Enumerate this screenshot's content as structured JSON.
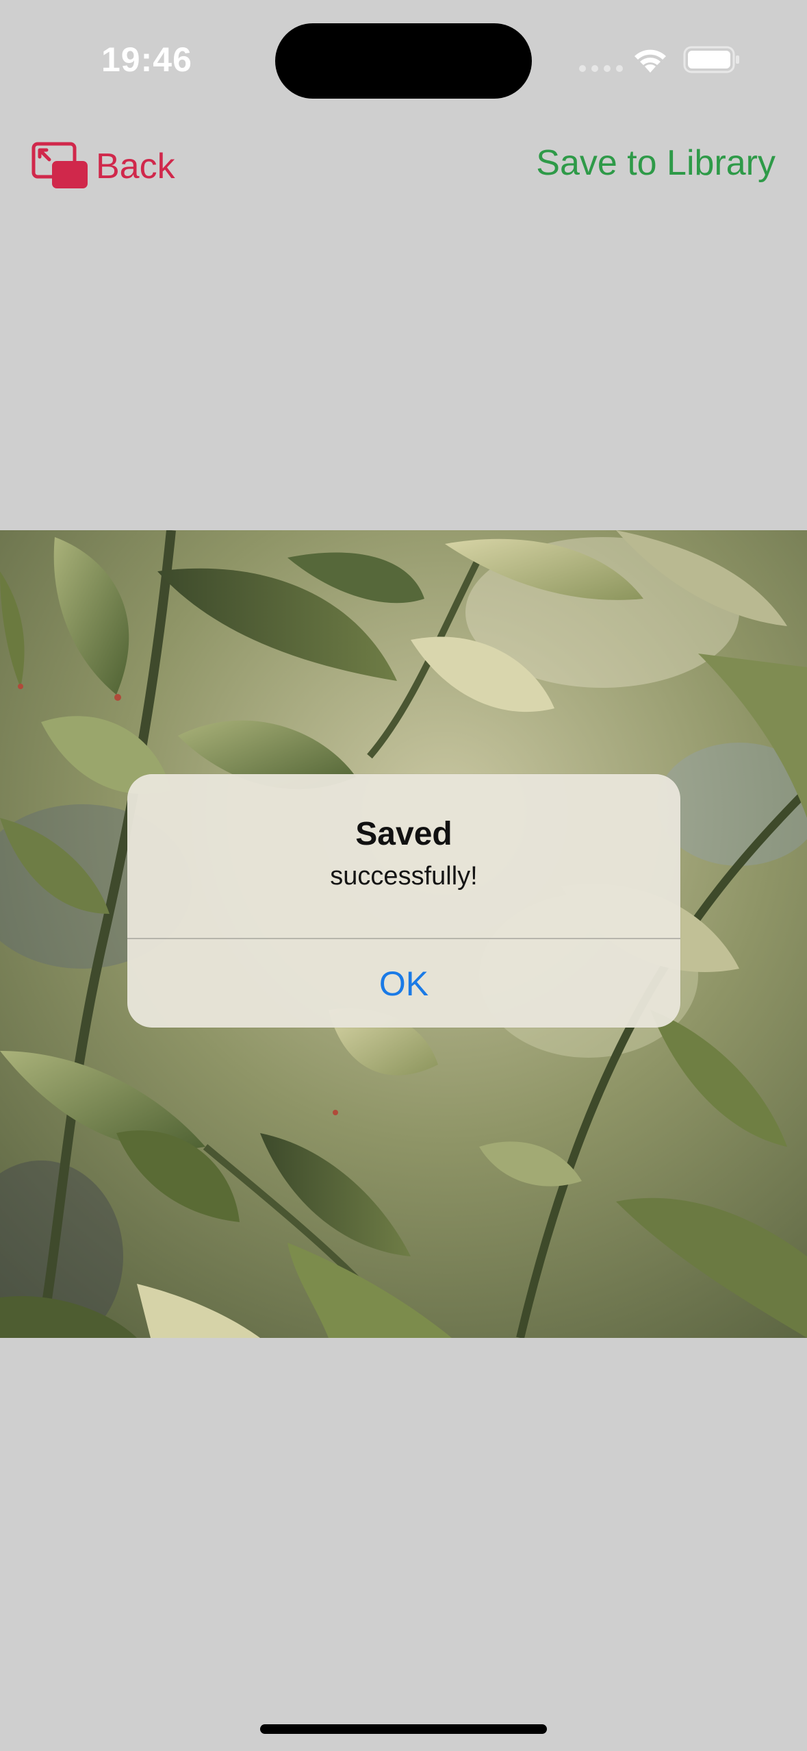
{
  "status_bar": {
    "time": "19:46",
    "icons": [
      "cellular-signal-icon",
      "wifi-icon",
      "battery-icon"
    ]
  },
  "nav": {
    "back_label": "Back",
    "back_icon": "exit-pip-icon",
    "save_label": "Save to Library"
  },
  "photo": {
    "subject": "green-leaves-photo"
  },
  "alert": {
    "title": "Saved",
    "message": "successfully!",
    "ok_label": "OK"
  },
  "colors": {
    "back_accent": "#d0284b",
    "save_accent": "#2e9a48",
    "alert_button": "#1a7ae6",
    "background": "#cfcfcf"
  }
}
